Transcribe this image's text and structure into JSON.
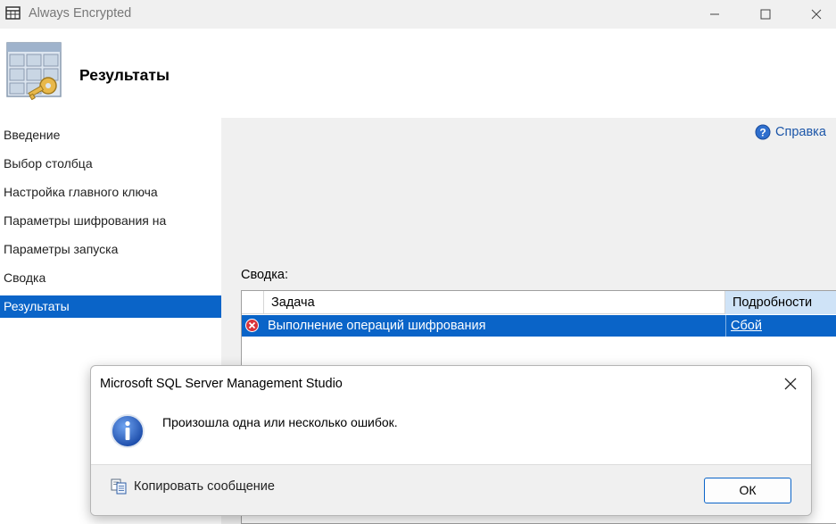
{
  "window": {
    "title": "Always Encrypted",
    "icon": "table-key-icon"
  },
  "header": {
    "title": "Результаты",
    "icon": "table-key-wizard-icon"
  },
  "nav": {
    "items": [
      {
        "label": "Введение",
        "selected": false
      },
      {
        "label": "Выбор столбца",
        "selected": false
      },
      {
        "label": "Настройка главного ключа",
        "selected": false
      },
      {
        "label": "Параметры шифрования на",
        "selected": false
      },
      {
        "label": "Параметры запуска",
        "selected": false
      },
      {
        "label": "Сводка",
        "selected": false
      },
      {
        "label": "Результаты",
        "selected": true
      }
    ]
  },
  "content": {
    "help_label": "Справка",
    "summary_label": "Сводка:",
    "grid": {
      "columns": [
        "Задача",
        "Подробности"
      ],
      "rows": [
        {
          "status": "error",
          "task": "Выполнение операций шифрования",
          "details": "Сбой"
        }
      ]
    }
  },
  "dialog": {
    "title": "Microsoft SQL Server Management Studio",
    "message": "Произошла одна или несколько ошибок.",
    "copy_label": "Копировать сообщение",
    "ok_label": "ОК"
  },
  "colors": {
    "selection": "#0a64c8",
    "header_highlight": "#cfe3f7",
    "link": "#1b55a8",
    "error": "#d9343b"
  }
}
